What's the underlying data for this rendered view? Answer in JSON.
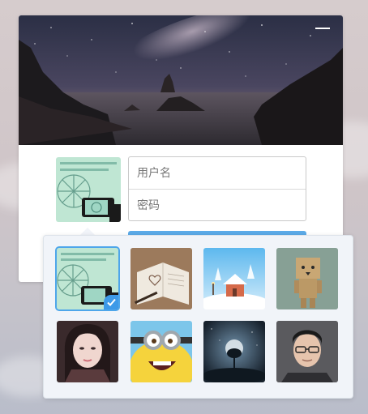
{
  "login": {
    "username_placeholder": "用户名",
    "password_placeholder": "密码"
  },
  "avatars": {
    "selected_index": 0,
    "items": [
      {
        "icon": "ferris-wheel-photo"
      },
      {
        "icon": "notebook-heart-photo"
      },
      {
        "icon": "snowy-house-photo"
      },
      {
        "icon": "cardboard-robot-photo"
      },
      {
        "icon": "girl-portrait-photo"
      },
      {
        "icon": "minion-photo"
      },
      {
        "icon": "night-tree-photo"
      },
      {
        "icon": "boy-portrait-photo"
      }
    ]
  },
  "colors": {
    "accent": "#5cabe8",
    "selected_border": "#4ea6ea"
  }
}
